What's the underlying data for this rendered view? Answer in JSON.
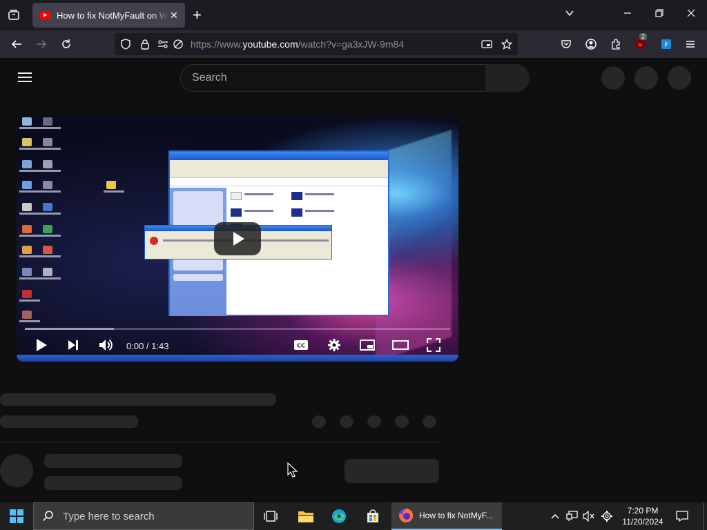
{
  "browser": {
    "tab_title": "How to fix NotMyFault on Windows",
    "url_prefix": "https://www.",
    "url_domain": "youtube.com",
    "url_path": "/watch?v=ga3xJW-9m84",
    "ublock_badge": "2"
  },
  "youtube": {
    "search_placeholder": "Search"
  },
  "player": {
    "time": "0:00 / 1:43",
    "buffered_fraction": 0.21
  },
  "taskbar": {
    "search_placeholder": "Type here to search",
    "active_app_title": "How to fix NotMyF...",
    "time": "7:20 PM",
    "date": "11/20/2024"
  },
  "colors": {
    "youtube_red": "#ff0000",
    "firefox_tab": "#42414d",
    "taskbar_accent": "#76b9ed"
  }
}
